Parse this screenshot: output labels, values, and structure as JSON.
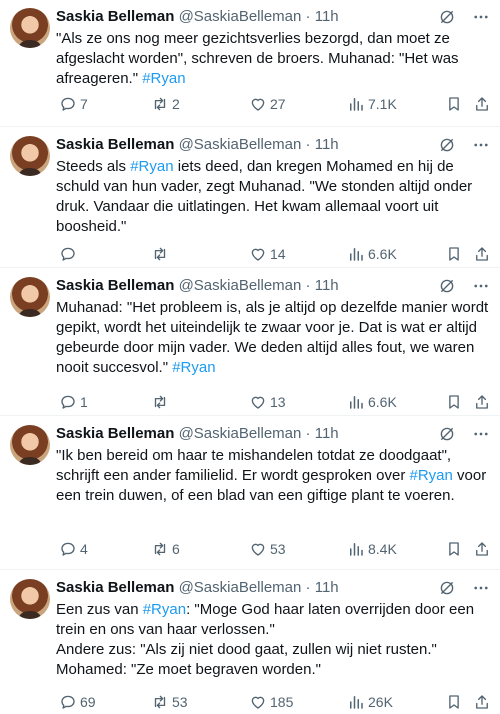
{
  "tweets": [
    {
      "name": "Saskia Belleman",
      "handle": "@SaskiaBelleman",
      "time": "11h",
      "segments": [
        {
          "t": "\"Als ze ons nog meer gezichtsverlies bezorgd, dan moet ze afgeslacht worden\", schreven de broers. Muhanad: \"Het was afreageren.\" "
        },
        {
          "t": "#Ryan",
          "h": true
        }
      ],
      "replies": "7",
      "retweets": "2",
      "likes": "27",
      "views": "7.1K"
    },
    {
      "name": "Saskia Belleman",
      "handle": "@SaskiaBelleman",
      "time": "11h",
      "segments": [
        {
          "t": "Steeds als "
        },
        {
          "t": "#Ryan",
          "h": true
        },
        {
          "t": " iets deed, dan kregen Mohamed en hij de schuld van hun vader, zegt Muhanad. \"We stonden altijd onder druk. Vandaar die uitlatingen. Het kwam allemaal voort uit boosheid.\""
        }
      ],
      "replies": "",
      "retweets": "",
      "likes": "14",
      "views": "6.6K"
    },
    {
      "name": "Saskia Belleman",
      "handle": "@SaskiaBelleman",
      "time": "11h",
      "segments": [
        {
          "t": "Muhanad: \"Het probleem is, als je altijd op dezelfde manier wordt gepikt, wordt het uiteindelijk te zwaar voor je. Dat is wat er altijd gebeurde door mijn vader. We deden altijd alles fout, we waren nooit succesvol.\" "
        },
        {
          "t": "#Ryan",
          "h": true
        }
      ],
      "replies": "1",
      "retweets": "",
      "likes": "13",
      "views": "6.6K"
    },
    {
      "name": "Saskia Belleman",
      "handle": "@SaskiaBelleman",
      "time": "11h",
      "segments": [
        {
          "t": "\"Ik ben bereid om haar te mishandelen totdat ze doodgaat\", schrijft een ander familielid. Er wordt gesproken over "
        },
        {
          "t": "#Ryan",
          "h": true
        },
        {
          "t": " voor een trein duwen, of een blad van een giftige plant te voeren."
        }
      ],
      "replies": "4",
      "retweets": "6",
      "likes": "53",
      "views": "8.4K"
    },
    {
      "name": "Saskia Belleman",
      "handle": "@SaskiaBelleman",
      "time": "11h",
      "segments": [
        {
          "t": "Een zus van "
        },
        {
          "t": "#Ryan",
          "h": true
        },
        {
          "t": ": \"Moge God haar laten overrijden door een trein en ons van haar verlossen.\"\nAndere zus: \"Als zij niet dood gaat, zullen wij niet rusten.\"\nMohamed: \"Ze moet begraven worden.\""
        }
      ],
      "replies": "69",
      "retweets": "53",
      "likes": "185",
      "views": "26K"
    }
  ],
  "separator": "·",
  "colors": {
    "text": "#0f1419",
    "muted": "#536471",
    "link": "#1d9bf0",
    "border": "#eff3f4"
  },
  "icons": {
    "header": [
      "grok-icon",
      "more-icon"
    ],
    "actions": [
      "reply-icon",
      "retweet-icon",
      "like-icon",
      "views-icon",
      "bookmark-icon",
      "share-icon"
    ]
  }
}
